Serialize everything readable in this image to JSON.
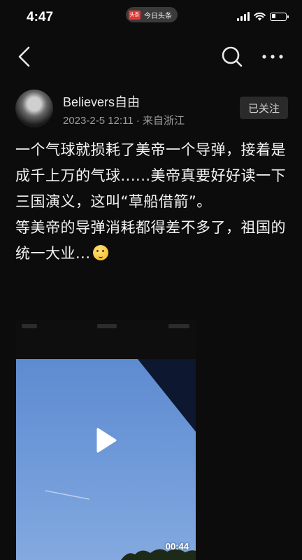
{
  "status_bar": {
    "time": "4:47",
    "app_logo_text": "头条",
    "app_name": "今日头条",
    "battery_level": 0.3
  },
  "nav": {
    "back_icon": "chevron-left-icon",
    "search_icon": "search-icon",
    "more_icon": "more-horizontal-icon"
  },
  "author": {
    "name": "Believers自由",
    "date": "2023-2-5 12:11",
    "separator": " · ",
    "location": "来自浙江",
    "follow_label": "已关注"
  },
  "post": {
    "text": "一个气球就损耗了美帝一个导弹，接着是成千上万的气球......美帝真要好好读一下三国演义，这叫“草船借箭”。\n等美帝的导弹消耗都得差不多了，祖国的统一大业...",
    "emoji": "thinking-face-emoji"
  },
  "video": {
    "duration": "00:44",
    "play_icon": "play-icon"
  },
  "colors": {
    "background": "#0c0c0c",
    "text": "#f4f4f4",
    "meta": "#9a9a9a",
    "follow_bg": "#2a2a2a",
    "app_logo": "#e53935"
  }
}
